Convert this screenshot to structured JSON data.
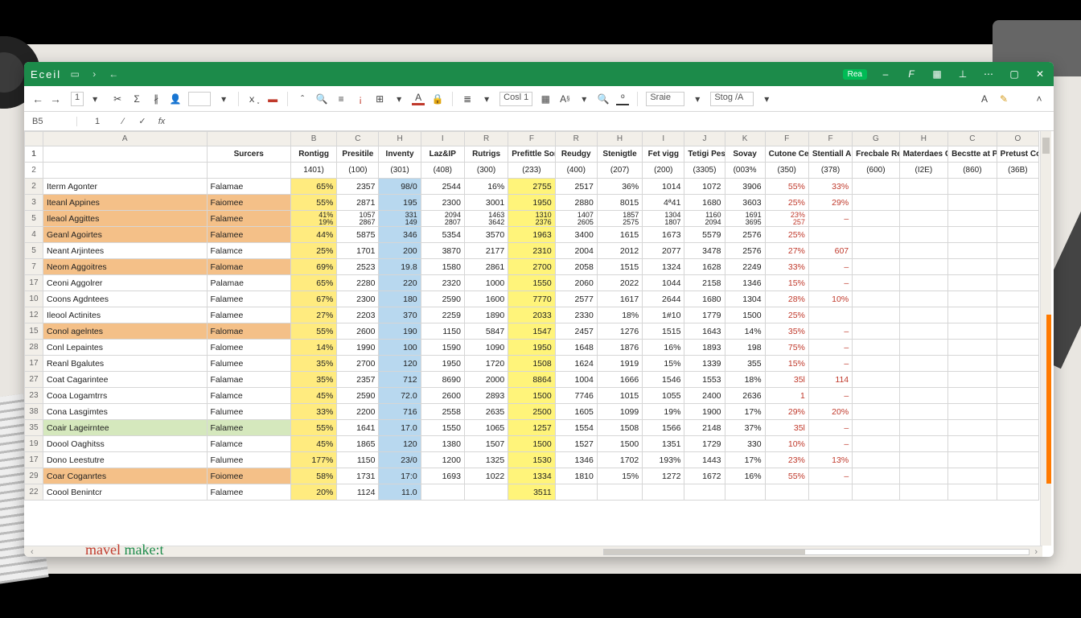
{
  "app": {
    "name": "Eceil",
    "cellref": "B5"
  },
  "titlebar_right": {
    "item1": "Rea"
  },
  "ribbon": {
    "font_num": "1",
    "style_hint1": "Cosl 1",
    "scale": "Sraie",
    "stog": "Stog /A"
  },
  "col_letters": [
    "",
    "A",
    "",
    "B",
    "C",
    "H",
    "I",
    "R",
    "F",
    "R",
    "H",
    "I",
    "J",
    "K",
    "F",
    "F",
    "G",
    "H",
    "C",
    "O"
  ],
  "hdr1": [
    "",
    "",
    "Surcers",
    "Rontigg",
    "Presitile",
    "Inventy",
    "Laz&IP",
    "Rutrigs",
    "Prefittle Somtl",
    "Reudgy",
    "Stenigtle",
    "Fet vigg",
    "Tetigi Pesfittes",
    "Sovay",
    "Cutone Cerides",
    "Stentiall Alcsert",
    "Frecbale Resitons",
    "Materdaes Canord",
    "Becstte at Prennient",
    "Pretust Conles"
  ],
  "hdr2": [
    "",
    "",
    "",
    "1401)",
    "(100)",
    "(301)",
    "(408)",
    "(300)",
    "(233)",
    "(400)",
    "(207)",
    "(200)",
    "(3305)",
    "(003%",
    "(350)",
    "(378)",
    "(600)",
    "(I2E)",
    "(860)",
    "(36B)"
  ],
  "rows": [
    {
      "n": "2",
      "hl": "",
      "a": "Iterm Agonter",
      "b": "Falamae",
      "p": "65%",
      "c": "2357",
      "h": "98/0",
      "i": "2544",
      "r": "16%",
      "ps": "2755",
      "re": "2517",
      "st": "36%",
      "fv": "1014",
      "tp": "1072",
      "so": "3906",
      "cu": "55%",
      "sa": "33%",
      "fr": "",
      "mc": "",
      "bp": "",
      "pc": ""
    },
    {
      "n": "3",
      "hl": "o",
      "a": "Iteanl Appines",
      "b": "Faiomee",
      "p": "55%",
      "c": "2871",
      "h": "195",
      "i": "2300",
      "r": "3001",
      "ps": "1950",
      "re": "2880",
      "st": "8015",
      "fv": "4ª41",
      "tp": "1680",
      "so": "3603",
      "cu": "25%",
      "sa": "29%",
      "fr": "",
      "mc": "",
      "bp": "",
      "pc": ""
    },
    {
      "n": "5",
      "hl": "o",
      "a": "Ileaol Aggittes",
      "b": "Falamee",
      "p": "41% 19%",
      "c": "1057 2867",
      "h": "331 149",
      "i": "2094 2807",
      "r": "1463 3642",
      "ps": "1310 2376",
      "re": "1407 2605",
      "st": "1857 2575",
      "fv": "1304 1807",
      "tp": "1160 2094",
      "so": "1691 3695",
      "cu": "23% 257",
      "sa": "–",
      "fr": "",
      "mc": "",
      "bp": "",
      "pc": ""
    },
    {
      "n": "4",
      "hl": "o",
      "a": "Geanl Agoirtes",
      "b": "Falamee",
      "p": "44%",
      "c": "5875",
      "h": "346",
      "i": "5354",
      "r": "3570",
      "ps": "1963",
      "re": "3400",
      "st": "1615",
      "fv": "1673",
      "tp": "5579",
      "so": "2576",
      "cu": "25%",
      "sa": "",
      "fr": "",
      "mc": "",
      "bp": "",
      "pc": ""
    },
    {
      "n": "5",
      "hl": "",
      "a": "Neant Arjintees",
      "b": "Falamce",
      "p": "25%",
      "c": "1701",
      "h": "200",
      "i": "3870",
      "r": "2177",
      "ps": "2310",
      "re": "2004",
      "st": "2012",
      "fv": "2077",
      "tp": "3478",
      "so": "2576",
      "cu": "27%",
      "sa": "607",
      "fr": "",
      "mc": "",
      "bp": "",
      "pc": ""
    },
    {
      "n": "7",
      "hl": "o",
      "a": "Neom Aggoitres",
      "b": "Falomae",
      "p": "69%",
      "c": "2523",
      "h": "19.8",
      "i": "1580",
      "r": "2861",
      "ps": "2700",
      "re": "2058",
      "st": "1515",
      "fv": "1324",
      "tp": "1628",
      "so": "2249",
      "cu": "33%",
      "sa": "–",
      "fr": "",
      "mc": "",
      "bp": "",
      "pc": ""
    },
    {
      "n": "17",
      "hl": "",
      "a": "Ceoni Aggolrer",
      "b": "Palamae",
      "p": "65%",
      "c": "2280",
      "h": "220",
      "i": "2320",
      "r": "1000",
      "ps": "1550",
      "re": "2060",
      "st": "2022",
      "fv": "1044",
      "tp": "2158",
      "so": "1346",
      "cu": "15%",
      "sa": "–",
      "fr": "",
      "mc": "",
      "bp": "",
      "pc": ""
    },
    {
      "n": "10",
      "hl": "",
      "a": "Coons Agdntees",
      "b": "Falamee",
      "p": "67%",
      "c": "2300",
      "h": "180",
      "i": "2590",
      "r": "1600",
      "ps": "7770",
      "re": "2577",
      "st": "1617",
      "fv": "2644",
      "tp": "1680",
      "so": "1304",
      "cu": "28%",
      "sa": "10%",
      "fr": "",
      "mc": "",
      "bp": "",
      "pc": ""
    },
    {
      "n": "12",
      "hl": "",
      "a": "Ileool Actinites",
      "b": "Falamee",
      "p": "27%",
      "c": "2203",
      "h": "370",
      "i": "2259",
      "r": "1890",
      "ps": "2033",
      "re": "2330",
      "st": "18%",
      "fv": "1#10",
      "tp": "1779",
      "so": "1500",
      "cu": "25%",
      "sa": "",
      "fr": "",
      "mc": "",
      "bp": "",
      "pc": ""
    },
    {
      "n": "15",
      "hl": "o",
      "a": "Conol agelntes",
      "b": "Falomae",
      "p": "55%",
      "c": "2600",
      "h": "190",
      "i": "1150",
      "r": "5847",
      "ps": "1547",
      "re": "2457",
      "st": "1276",
      "fv": "1515",
      "tp": "1643",
      "so": "14%",
      "cu": "35%",
      "sa": "–",
      "fr": "",
      "mc": "",
      "bp": "",
      "pc": ""
    },
    {
      "n": "28",
      "hl": "",
      "a": "Conl Lepaintes",
      "b": "Falomee",
      "p": "14%",
      "c": "1990",
      "h": "100",
      "i": "1590",
      "r": "1090",
      "ps": "1950",
      "re": "1648",
      "st": "1876",
      "fv": "16%",
      "tp": "1893",
      "so": "198",
      "cu": "75%",
      "sa": "–",
      "fr": "",
      "mc": "",
      "bp": "",
      "pc": ""
    },
    {
      "n": "17",
      "hl": "",
      "a": "Reanl Bgalutes",
      "b": "Falumee",
      "p": "35%",
      "c": "2700",
      "h": "120",
      "i": "1950",
      "r": "1720",
      "ps": "1508",
      "re": "1624",
      "st": "1919",
      "fv": "15%",
      "tp": "1339",
      "so": "355",
      "cu": "15%",
      "sa": "–",
      "fr": "",
      "mc": "",
      "bp": "",
      "pc": ""
    },
    {
      "n": "27",
      "hl": "",
      "a": "Coat Cagarintee",
      "b": "Falamae",
      "p": "35%",
      "c": "2357",
      "h": "712",
      "i": "8690",
      "r": "2000",
      "ps": "8864",
      "re": "1004",
      "st": "1666",
      "fv": "1546",
      "tp": "1553",
      "so": "18%",
      "cu": "35l",
      "sa": "114",
      "fr": "",
      "mc": "",
      "bp": "",
      "pc": ""
    },
    {
      "n": "23",
      "hl": "",
      "a": "Cooa Logamtrrs",
      "b": "Falamce",
      "p": "45%",
      "c": "2590",
      "h": "72.0",
      "i": "2600",
      "r": "2893",
      "ps": "1500",
      "re": "7746",
      "st": "1015",
      "fv": "1055",
      "tp": "2400",
      "so": "2636",
      "cu": "1",
      "sa": "–",
      "fr": "",
      "mc": "",
      "bp": "",
      "pc": ""
    },
    {
      "n": "38",
      "hl": "",
      "a": "Cona Lasgimtes",
      "b": "Falumee",
      "p": "33%",
      "c": "2200",
      "h": "716",
      "i": "2558",
      "r": "2635",
      "ps": "2500",
      "re": "1605",
      "st": "1099",
      "fv": "19%",
      "tp": "1900",
      "so": "17%",
      "cu": "29%",
      "sa": "20%",
      "fr": "",
      "mc": "",
      "bp": "",
      "pc": ""
    },
    {
      "n": "35",
      "hl": "g",
      "a": "Coair Lageirntee",
      "b": "Falamee",
      "p": "55%",
      "c": "1641",
      "h": "17.0",
      "i": "1550",
      "r": "1065",
      "ps": "1257",
      "re": "1554",
      "st": "1508",
      "fv": "1566",
      "tp": "2148",
      "so": "37%",
      "cu": "35l",
      "sa": "–",
      "fr": "",
      "mc": "",
      "bp": "",
      "pc": ""
    },
    {
      "n": "19",
      "hl": "",
      "a": "Doool Oaghitss",
      "b": "Falamce",
      "p": "45%",
      "c": "1865",
      "h": "120",
      "i": "1380",
      "r": "1507",
      "ps": "1500",
      "re": "1527",
      "st": "1500",
      "fv": "1351",
      "tp": "1729",
      "so": "330",
      "cu": "10%",
      "sa": "–",
      "fr": "",
      "mc": "",
      "bp": "",
      "pc": ""
    },
    {
      "n": "17",
      "hl": "",
      "a": "Dono Leestutre",
      "b": "Falumee",
      "p": "177%",
      "c": "1150",
      "h": "23/0",
      "i": "1200",
      "r": "1325",
      "ps": "1530",
      "re": "1346",
      "st": "1702",
      "fv": "193%",
      "tp": "1443",
      "so": "17%",
      "cu": "23%",
      "sa": "13%",
      "fr": "",
      "mc": "",
      "bp": "",
      "pc": ""
    },
    {
      "n": "29",
      "hl": "o",
      "a": "Coar Coganrtes",
      "b": "Foiomee",
      "p": "58%",
      "c": "1731",
      "h": "17:0",
      "i": "1693",
      "r": "1022",
      "ps": "1334",
      "re": "1810",
      "st": "15%",
      "fv": "1272",
      "tp": "1672",
      "so": "16%",
      "cu": "55%",
      "sa": "–",
      "fr": "",
      "mc": "",
      "bp": "",
      "pc": ""
    },
    {
      "n": "22",
      "hl": "",
      "a": "Coool Benintcr",
      "b": "Falamee",
      "p": "20%",
      "c": "1124",
      "h": "11.0",
      "i": "",
      "r": "",
      "ps": "3511",
      "re": "",
      "st": "",
      "fv": "",
      "tp": "",
      "so": "",
      "cu": "",
      "sa": "",
      "fr": "",
      "mc": "",
      "bp": "",
      "pc": ""
    }
  ],
  "watermark": {
    "a": "mavel ",
    "b": "make:t"
  }
}
